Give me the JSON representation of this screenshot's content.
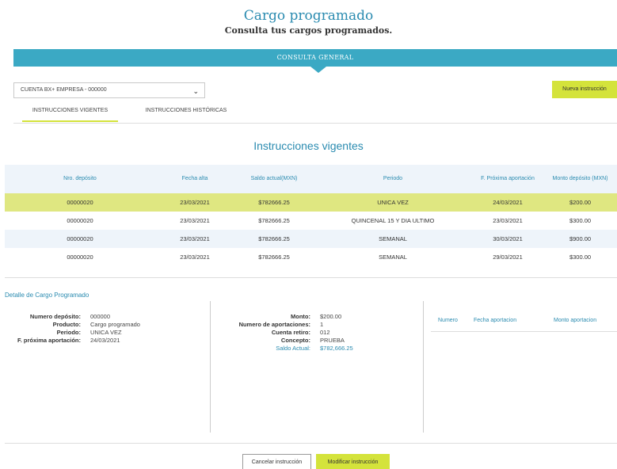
{
  "header": {
    "title": "Cargo programado",
    "subtitle": "Consulta tus cargos programados."
  },
  "banner": {
    "label": "CONSULTA GENERAL"
  },
  "account_select": {
    "value": "CUENTA BX+ EMPRESA - 000000"
  },
  "buttons": {
    "nueva": "Nueva instrucción",
    "cancelar": "Cancelar instrucción",
    "modificar": "Modificar instrucción"
  },
  "tabs": [
    {
      "label": "INSTRUCCIONES VIGENTES",
      "active": true
    },
    {
      "label": "INSTRUCCIONES HISTÓRICAS",
      "active": false
    }
  ],
  "section_title": "Instrucciones vigentes",
  "table": {
    "headers": [
      "Nro. depósito",
      "Fecha alta",
      "Saldo actual(MXN)",
      "Periodo",
      "F. Próxima aportación",
      "Monto depósito (MXN)"
    ],
    "rows": [
      [
        "00000020",
        "23/03/2021",
        "$782666.25",
        "UNICA VEZ",
        "24/03/2021",
        "$200.00"
      ],
      [
        "00000020",
        "23/03/2021",
        "$782666.25",
        "QUINCENAL 15 Y DIA ULTIMO",
        "23/03/2021",
        "$300.00"
      ],
      [
        "00000020",
        "23/03/2021",
        "$782666.25",
        "SEMANAL",
        "30/03/2021",
        "$900.00"
      ],
      [
        "00000020",
        "23/03/2021",
        "$782666.25",
        "SEMANAL",
        "29/03/2021",
        "$300.00"
      ]
    ]
  },
  "detail": {
    "title": "Detalle de Cargo Programado",
    "left": [
      {
        "label": "Numero depósito:",
        "value": "000000"
      },
      {
        "label": "Producto:",
        "value": "Cargo programado"
      },
      {
        "label": "Periodo:",
        "value": "UNICA VEZ"
      },
      {
        "label": "F. próxima aportación:",
        "value": "24/03/2021"
      }
    ],
    "middle": [
      {
        "label": "Monto:",
        "value": "$200.00"
      },
      {
        "label": "Numero de aportaciones:",
        "value": "1"
      },
      {
        "label": "Cuenta retiro:",
        "value": "012"
      },
      {
        "label": "Concepto:",
        "value": "PRUEBA"
      },
      {
        "label": "Saldo Actual:",
        "value": "$782,666.25"
      }
    ],
    "right_headers": [
      "Numero",
      "Fecha aportacion",
      "Monto aportacion"
    ]
  },
  "colors": {
    "accent": "#3ba9c4",
    "highlight": "#d4e33b",
    "link": "#2a8bb0"
  }
}
